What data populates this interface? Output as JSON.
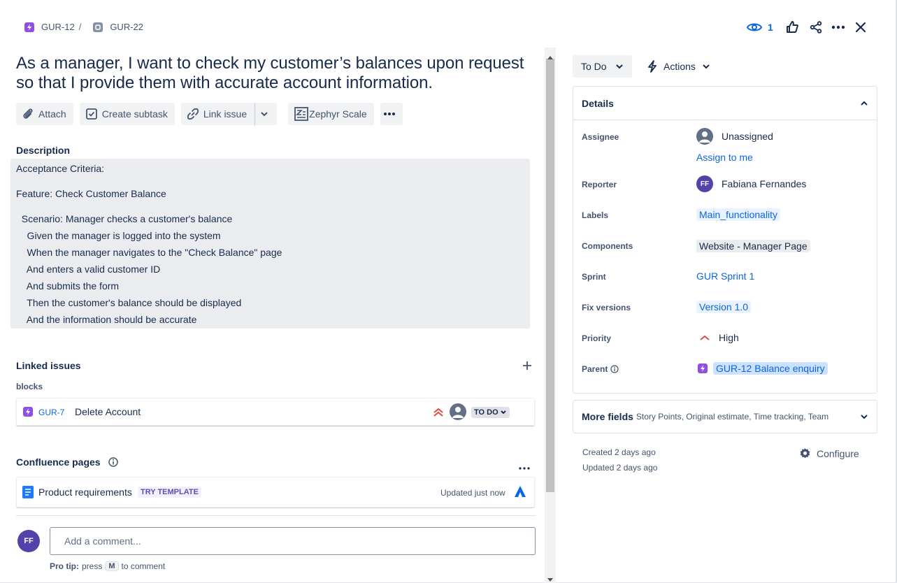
{
  "breadcrumb": {
    "parent_key": "GUR-12",
    "separator": "/",
    "current_key": "GUR-22"
  },
  "header": {
    "watch_count": "1"
  },
  "issue": {
    "title_line1": "As a manager, I want to check my customer’s balances upon request",
    "title_line2": "so that I provide them with accurate account information."
  },
  "toolbar": {
    "attach": "Attach",
    "create_subtask": "Create subtask",
    "link_issue": "Link issue",
    "zephyr": "Zephyr Scale"
  },
  "description": {
    "heading": "Description",
    "lines": [
      "Acceptance Criteria:",
      "Feature: Check Customer Balance",
      "  Scenario: Manager checks a customer's balance",
      "    Given the manager is logged into the system",
      "    When the manager navigates to the \"Check Balance\" page",
      "    And enters a valid customer ID",
      "    And submits the form",
      "    Then the customer's balance should be displayed",
      "    And the information should be accurate"
    ]
  },
  "linked_issues": {
    "heading": "Linked issues",
    "relation": "blocks",
    "items": [
      {
        "key": "GUR-7",
        "summary": "Delete Account",
        "status": "TO DO"
      }
    ]
  },
  "confluence": {
    "heading": "Confluence pages",
    "items": [
      {
        "title": "Product requirements",
        "badge": "TRY TEMPLATE",
        "updated": "Updated just now"
      }
    ]
  },
  "comment": {
    "avatar_initials": "FF",
    "placeholder": "Add a comment...",
    "tip_label": "Pro tip:",
    "tip_press": "press",
    "tip_key": "M",
    "tip_suffix": "to comment"
  },
  "status": {
    "current": "To Do",
    "actions_label": "Actions"
  },
  "details": {
    "heading": "Details",
    "assignee_label": "Assignee",
    "assignee_value": "Unassigned",
    "assign_to_me": "Assign to me",
    "reporter_label": "Reporter",
    "reporter_initials": "FF",
    "reporter_value": "Fabiana Fernandes",
    "labels_label": "Labels",
    "labels_value": "Main_functionality",
    "components_label": "Components",
    "components_value": "Website - Manager Page",
    "sprint_label": "Sprint",
    "sprint_value": "GUR Sprint 1",
    "fix_versions_label": "Fix versions",
    "fix_versions_value": "Version 1.0",
    "priority_label": "Priority",
    "priority_value": "High",
    "parent_label": "Parent",
    "parent_value": "GUR-12 Balance enquiry"
  },
  "more_fields": {
    "label": "More fields",
    "hint": "Story Points, Original estimate, Time tracking, Team"
  },
  "meta": {
    "created": "Created 2 days ago",
    "updated": "Updated 2 days ago",
    "configure": "Configure"
  },
  "colors": {
    "link": "#0c66e4",
    "story": "#904ee2",
    "priority_high": "#e2483d",
    "avatar": "#5243aa"
  }
}
